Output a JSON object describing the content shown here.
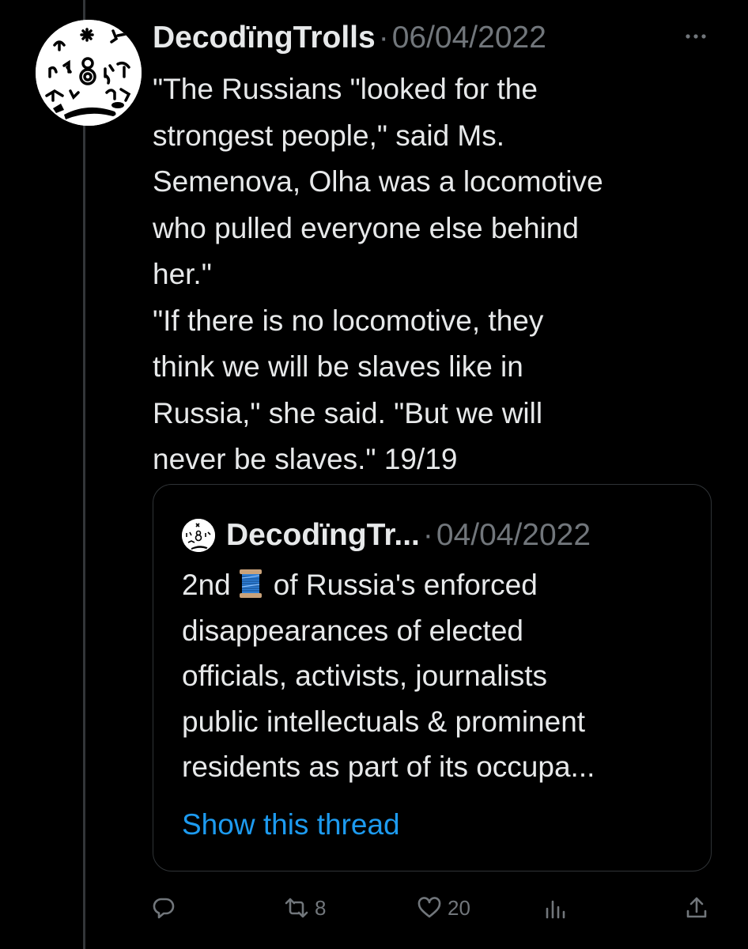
{
  "post": {
    "author_name": "DecodïngTrolls",
    "separator": "·",
    "date": "06/04/2022",
    "text_lines": [
      "\"The Russians \"looked for the",
      "strongest people,\" said Ms.",
      "Semenova, Olha was a locomotive",
      "who pulled everyone else behind",
      "her.\"",
      "\"If there is no locomotive, they",
      "think we will be slaves like in",
      "Russia,\" she said. \"But we will",
      "never be slaves.\" 19/19"
    ],
    "more_icon": "more-horizontal-icon"
  },
  "quote": {
    "author_name": "DecodïngTr...",
    "separator": "·",
    "date": "04/04/2022",
    "lead": "2nd",
    "emoji_icon": "thread-spool-icon",
    "text_first_rest": "of Russia's enforced",
    "text_lines": [
      "disappearances of elected",
      "officials, activists, journalists",
      "public intellectuals & prominent",
      "residents as part of its occupa..."
    ],
    "show_thread": "Show this thread"
  },
  "actions": {
    "reply_icon": "reply-icon",
    "repost_icon": "repost-icon",
    "repost_count": "8",
    "like_icon": "heart-icon",
    "like_count": "20",
    "views_icon": "views-chart-icon",
    "share_icon": "share-icon"
  },
  "colors": {
    "background": "#000000",
    "text_primary": "#e7e9ea",
    "text_secondary": "#71767b",
    "link": "#1d9bf0",
    "border": "#2f3336",
    "thread_line": "#333639"
  }
}
